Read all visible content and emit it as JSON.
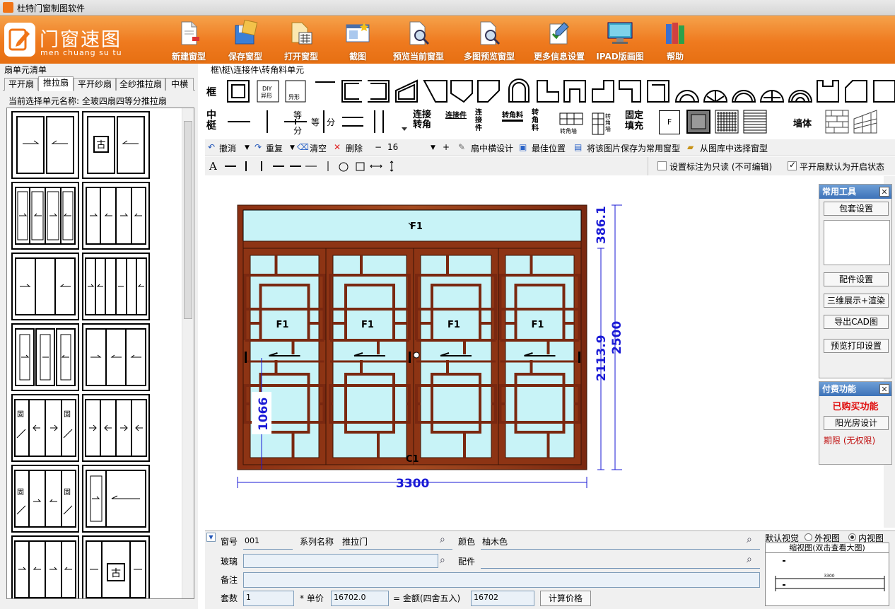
{
  "window": {
    "title": "杜特门窗制图软件"
  },
  "logo": {
    "cn": "门窗速图",
    "en": "men chuang su tu"
  },
  "ribbon": [
    {
      "label": "新建窗型",
      "icon": "new-document-icon"
    },
    {
      "label": "保存窗型",
      "icon": "save-icon"
    },
    {
      "label": "打开窗型",
      "icon": "open-file-icon"
    },
    {
      "label": "截图",
      "icon": "screenshot-icon"
    },
    {
      "label": "预览当前窗型",
      "icon": "preview-icon"
    },
    {
      "label": "多图预览窗型",
      "icon": "multi-preview-icon"
    },
    {
      "label": "更多信息设置",
      "icon": "settings-edit-icon"
    },
    {
      "label": "IPAD版画图",
      "icon": "ipad-icon"
    },
    {
      "label": "帮助",
      "icon": "help-books-icon"
    }
  ],
  "left": {
    "title": "扇单元清单",
    "tabs": [
      "平开扇",
      "推拉扇",
      "平开纱扇",
      "全纱推拉扇",
      "中横"
    ],
    "current_label": "当前选择单元名称: 全玻四扇四等分推拉扇"
  },
  "breadcrumb": "框\\梃\\连接件\\转角料单元",
  "palette": {
    "row1_label": "框",
    "row2_label": "中梃",
    "eq_split_top": "等",
    "eq_split_bottom": "分",
    "eq_label": "等",
    "split_label": "分",
    "connect_corner": "连接\n转角",
    "connector": "连接件",
    "connector_v": "连接件",
    "corner_h": "转角料",
    "corner_v": "转角料",
    "corner_wall": "转角墙",
    "corner_wall2": "转角墙",
    "fixed_fill": "固定\n填充",
    "f_label": "F",
    "wall": "墙体"
  },
  "editbar": {
    "undo": "撤消",
    "redo": "重复",
    "clear": "清空",
    "delete": "删除",
    "minus": "−",
    "value": "16",
    "plus": "+",
    "sash_mullion": "扇中横设计",
    "best_pos": "最佳位置",
    "save_common": "将该图片保存为常用窗型",
    "from_lib": "从图库中选择窗型"
  },
  "drawbar": {
    "text_tool": "A",
    "readonly_label": "设置标注为只读 (不可编辑)",
    "readonly_checked": false,
    "open_default_label": "平开扇默认为开启状态",
    "open_default_checked": true
  },
  "drawing": {
    "top_label": "F1",
    "sash_labels": [
      "F1",
      "F1",
      "F1",
      "F1"
    ],
    "connector_label": "C1",
    "dim_width": "3300",
    "dim_height": "2500",
    "dim_top": "386.1",
    "dim_lower": "2113.9",
    "dim_handle": "1066"
  },
  "tools_window": {
    "title": "常用工具",
    "buttons": [
      "包套设置",
      "配件设置",
      "三维展示+渲染",
      "导出CAD图",
      "预览打印设置"
    ]
  },
  "paid_window": {
    "title": "付费功能",
    "bought": "已购买功能",
    "sunroom": "阳光房设计",
    "term": "期限 (无权限)"
  },
  "props": {
    "window_no_label": "窗号",
    "window_no": "001",
    "series_label": "系列名称",
    "series": "推拉门",
    "color_label": "颜色",
    "color": "柚木色",
    "glass_label": "玻璃",
    "glass": "",
    "parts_label": "配件",
    "parts": "",
    "note_label": "备注",
    "note": "",
    "sets_label": "套数",
    "sets": "1",
    "price_label": "* 单价",
    "price": "16702.0",
    "amount_label": "= 金额(四舍五入)",
    "amount": "16702",
    "calc_button": "计算价格",
    "view_label": "默认视觉",
    "outer_view": "外视图",
    "inner_view": "内视图",
    "selected_view": "内视图",
    "thumb_title": "缩视图(双击查看大图)",
    "thumb_dim": "3300"
  },
  "colors": {
    "ribbon": "#ef7a1f",
    "frame_wood": "#7a2a12",
    "glass": "#c8f3f7",
    "dimension": "#1a1ad6",
    "paid_red": "#e01010"
  }
}
